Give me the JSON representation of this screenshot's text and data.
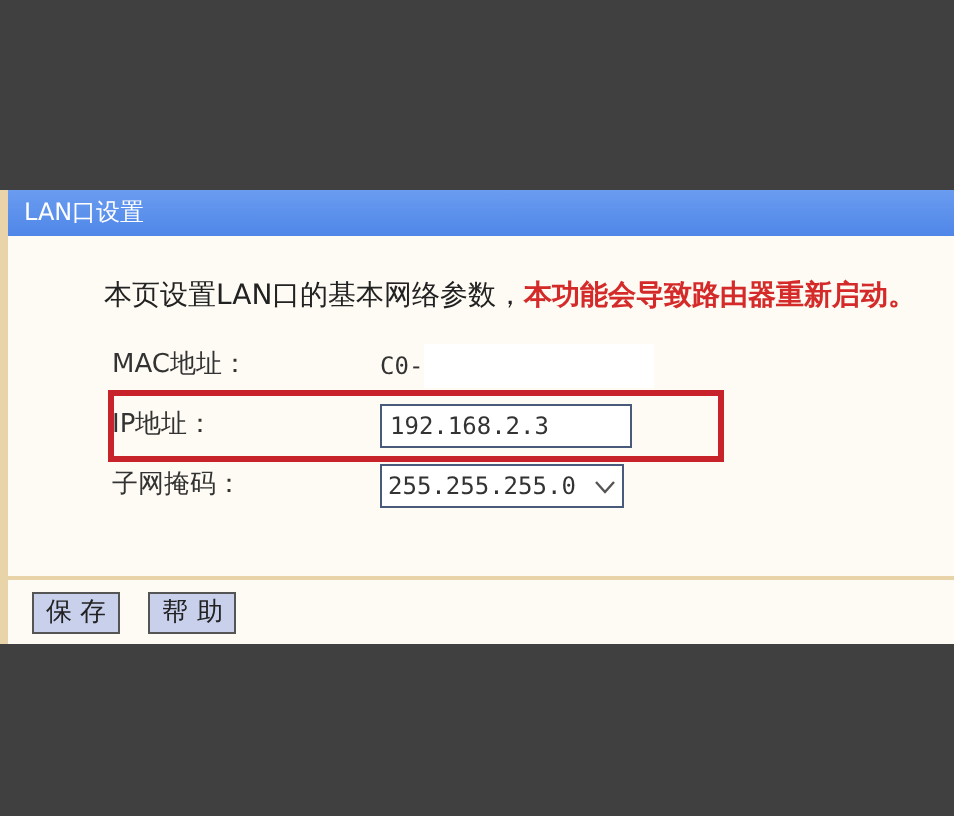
{
  "panel": {
    "title": "LAN口设置"
  },
  "intro": {
    "text": "本页设置LAN口的基本网络参数，",
    "warning": "本功能会导致路由器重新启动。"
  },
  "fields": [
    {
      "kind": "text",
      "label": "MAC地址：",
      "value": "C0-",
      "redacted": true,
      "highlighted": false
    },
    {
      "kind": "input",
      "label": "IP地址：",
      "value": "192.168.2.3",
      "highlighted": true
    },
    {
      "kind": "select",
      "label": "子网掩码：",
      "value": "255.255.255.0",
      "highlighted": false
    }
  ],
  "buttons": [
    "保 存",
    "帮 助"
  ]
}
